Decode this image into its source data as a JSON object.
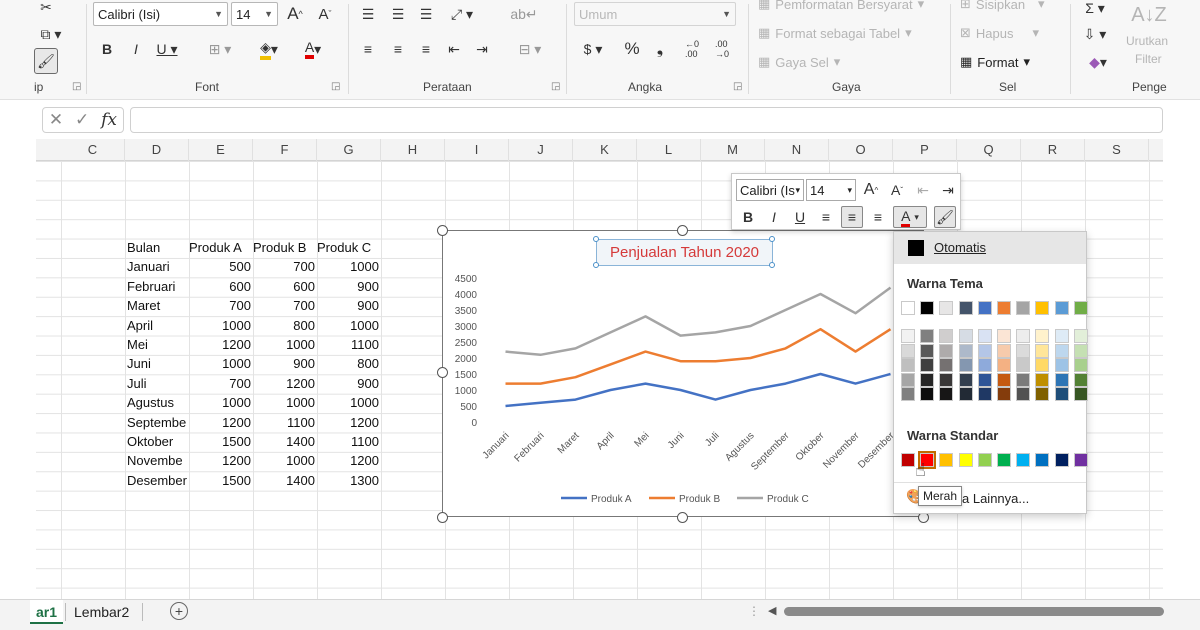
{
  "ribbon": {
    "font_name": "Calibri (Isi)",
    "font_size": "14",
    "number_format": "Umum",
    "conditional_format": "Pemformatan Bersyarat",
    "format_as_table": "Format sebagai Tabel",
    "cell_styles": "Gaya Sel",
    "insert": "Sisipkan",
    "delete": "Hapus",
    "format": "Format",
    "sort": "Urutkan",
    "filter": "Filter",
    "groups": {
      "clipboard": "ip",
      "font": "Font",
      "alignment": "Perataan",
      "number": "Angka",
      "styles": "Gaya",
      "cells": "Sel",
      "editing": "Penge"
    }
  },
  "formula_bar": {
    "fx": "fx",
    "value": ""
  },
  "columns": [
    "C",
    "D",
    "E",
    "F",
    "G",
    "H",
    "I",
    "J",
    "K",
    "L",
    "M",
    "N",
    "O",
    "P",
    "Q",
    "R",
    "S"
  ],
  "table": {
    "headers": [
      "Bulan",
      "Produk A",
      "Produk B",
      "Produk C"
    ],
    "rows": [
      [
        "Januari",
        "500",
        "700",
        "1000"
      ],
      [
        "Februari",
        "600",
        "600",
        "900"
      ],
      [
        "Maret",
        "700",
        "700",
        "900"
      ],
      [
        "April",
        "1000",
        "800",
        "1000"
      ],
      [
        "Mei",
        "1200",
        "1000",
        "1100"
      ],
      [
        "Juni",
        "1000",
        "900",
        "800"
      ],
      [
        "Juli",
        "700",
        "1200",
        "900"
      ],
      [
        "Agustus",
        "1000",
        "1000",
        "1000"
      ],
      [
        "Septembe",
        "1200",
        "1100",
        "1200"
      ],
      [
        "Oktober",
        "1500",
        "1400",
        "1100"
      ],
      [
        "Novembe",
        "1200",
        "1000",
        "1200"
      ],
      [
        "Desember",
        "1500",
        "1400",
        "1300"
      ]
    ]
  },
  "chart_data": {
    "type": "line",
    "title": "Penjualan Tahun 2020",
    "categories": [
      "Januari",
      "Februari",
      "Maret",
      "April",
      "Mei",
      "Juni",
      "Juli",
      "Agustus",
      "September",
      "Oktober",
      "November",
      "Desember"
    ],
    "series": [
      {
        "name": "Produk A",
        "values": [
          500,
          600,
          700,
          1000,
          1200,
          1000,
          700,
          1000,
          1200,
          1500,
          1200,
          1500
        ],
        "color": "#4472c4"
      },
      {
        "name": "Produk B",
        "values": [
          1200,
          1200,
          1400,
          1800,
          2200,
          1900,
          1900,
          2000,
          2300,
          2900,
          2200,
          2900
        ],
        "color": "#ed7d31"
      },
      {
        "name": "Produk C",
        "values": [
          2200,
          2100,
          2300,
          2800,
          3300,
          2700,
          2800,
          3000,
          3500,
          4000,
          3400,
          4200
        ],
        "color": "#a5a5a5"
      }
    ],
    "yticks": [
      "4500",
      "4000",
      "3500",
      "3000",
      "2500",
      "2000",
      "1500",
      "1000",
      "500",
      "0"
    ],
    "ylim": [
      0,
      4500
    ],
    "legend": "bottom",
    "grid": false
  },
  "mini_toolbar": {
    "font_name": "Calibri (Is",
    "font_size": "14"
  },
  "palette": {
    "automatic": "Otomatis",
    "theme_colors_label": "Warna Tema",
    "standard_colors_label": "Warna Standar",
    "more_colors": "a Lainnya...",
    "tooltip": "Merah",
    "theme_top": [
      "#ffffff",
      "#000000",
      "#e7e6e6",
      "#44546a",
      "#4472c4",
      "#ed7d31",
      "#a5a5a5",
      "#ffc000",
      "#5b9bd5",
      "#70ad47"
    ],
    "theme_shades": [
      [
        "#f2f2f2",
        "#d9d9d9",
        "#bfbfbf",
        "#a6a6a6",
        "#808080"
      ],
      [
        "#808080",
        "#595959",
        "#404040",
        "#262626",
        "#0d0d0d"
      ],
      [
        "#d0cece",
        "#aeabab",
        "#757171",
        "#3a3838",
        "#171616"
      ],
      [
        "#d6dce4",
        "#adb9ca",
        "#8497b0",
        "#333f4f",
        "#222a35"
      ],
      [
        "#d9e2f3",
        "#b4c6e7",
        "#8eaadb",
        "#2f5597",
        "#1f3864"
      ],
      [
        "#fbe5d5",
        "#f7cbac",
        "#f4b183",
        "#c55a11",
        "#843c0c"
      ],
      [
        "#ededed",
        "#dbdbdb",
        "#c9c9c9",
        "#7b7b7b",
        "#525252"
      ],
      [
        "#fff2cc",
        "#ffe699",
        "#ffd966",
        "#bf8f00",
        "#7f6000"
      ],
      [
        "#deebf6",
        "#bdd7ee",
        "#9dc3e6",
        "#2e75b5",
        "#1f4e79"
      ],
      [
        "#e2efd9",
        "#c5e0b3",
        "#a8d08d",
        "#538135",
        "#375623"
      ]
    ],
    "standard": [
      "#c00000",
      "#ff0000",
      "#ffc000",
      "#ffff00",
      "#92d050",
      "#00b050",
      "#00b0f0",
      "#0070c0",
      "#002060",
      "#7030a0"
    ]
  },
  "sheets": {
    "active": "ar1",
    "other": "Lembar2",
    "add": "+"
  }
}
